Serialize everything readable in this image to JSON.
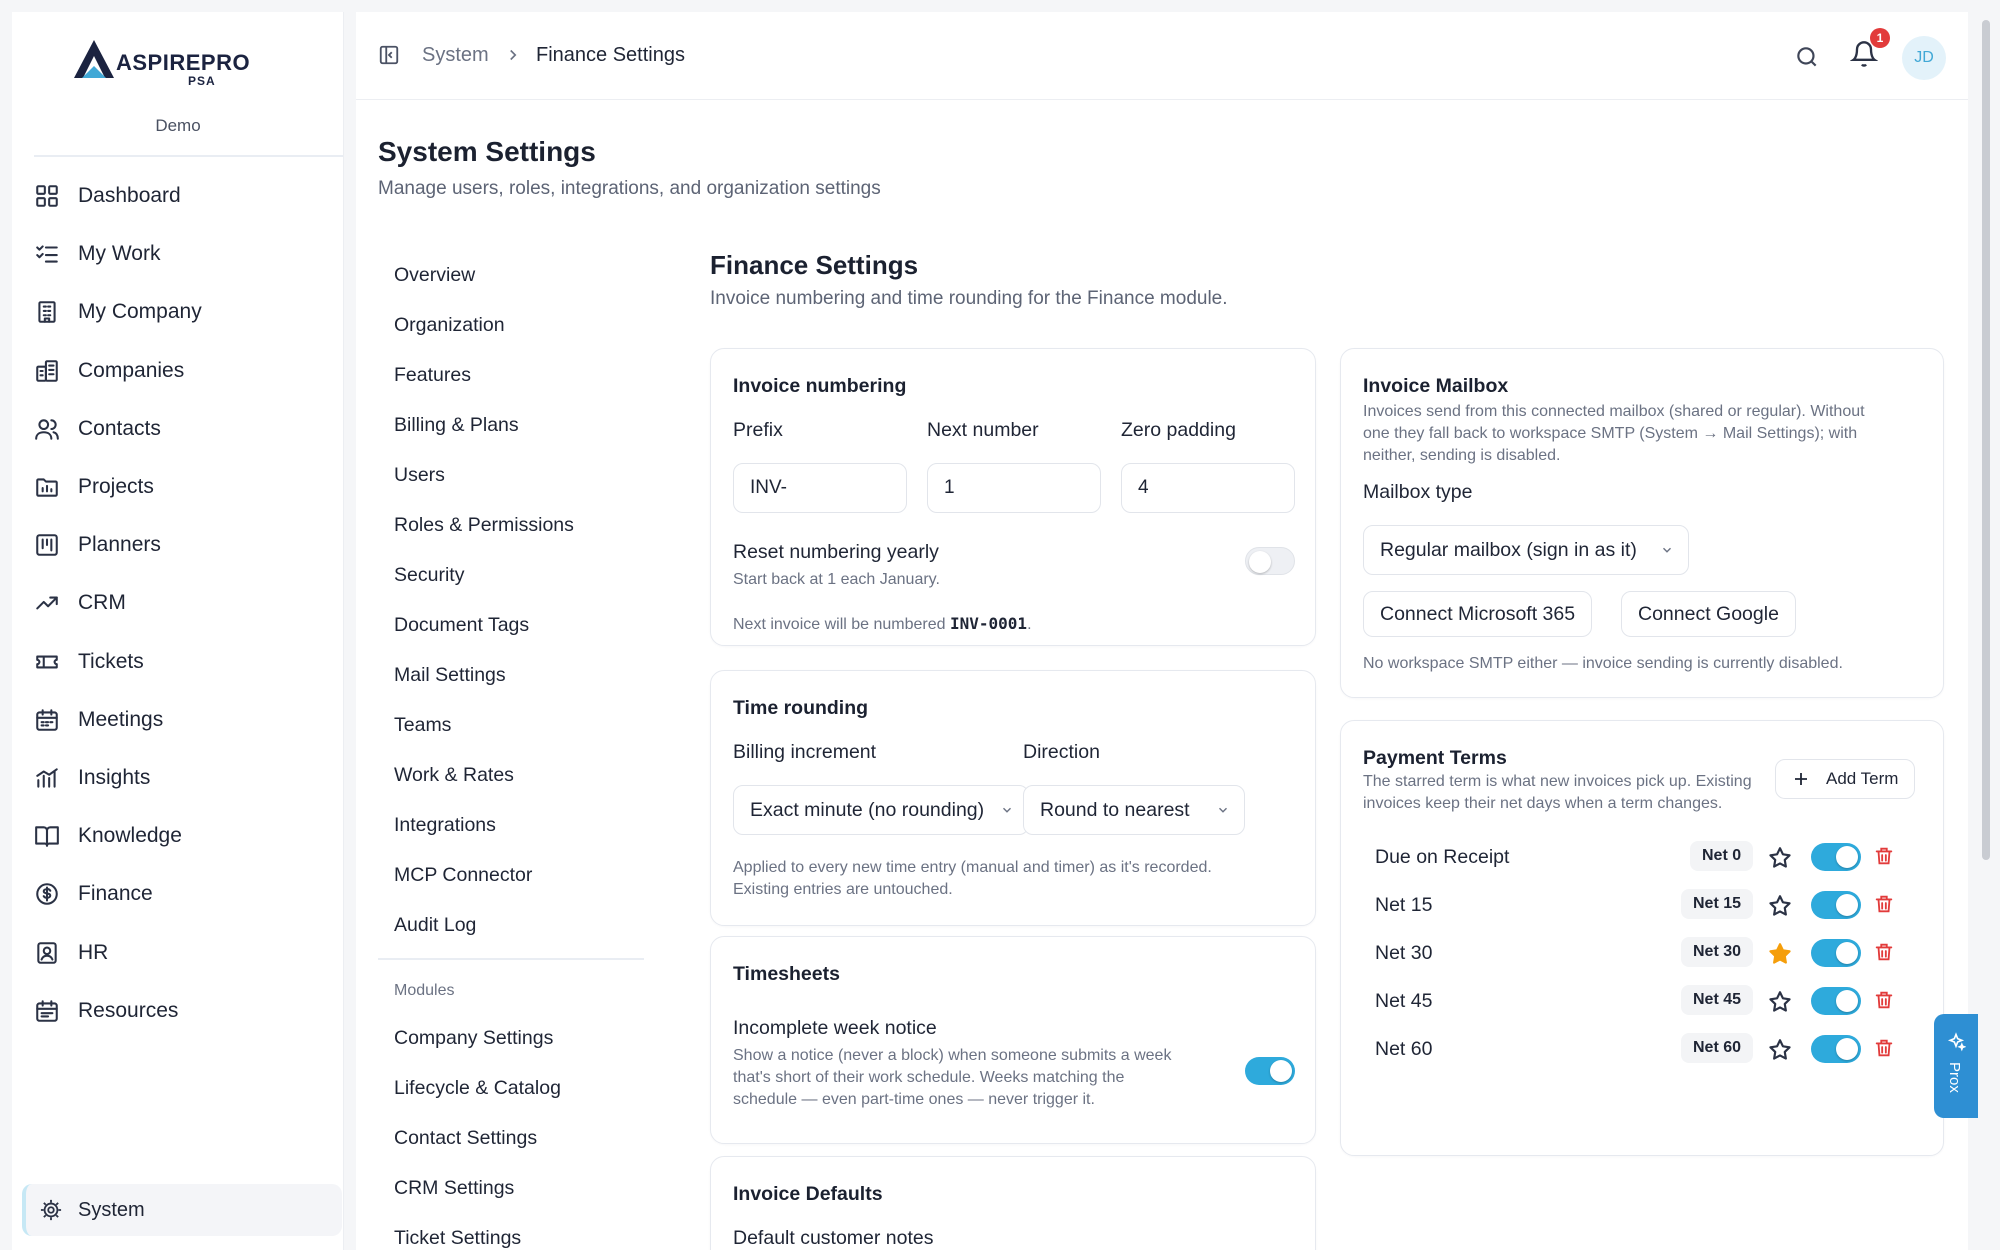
{
  "brand": {
    "name": "ASPIREPRO",
    "sub": "PSA",
    "workspace": "Demo"
  },
  "colors": {
    "accent": "#2eaadc",
    "danger": "#e23b3b",
    "star": "#f59e0b",
    "prox": "#2e8fd3"
  },
  "sidebar": {
    "items": [
      {
        "label": "Dashboard",
        "icon": "dashboard-icon"
      },
      {
        "label": "My Work",
        "icon": "list-check-icon"
      },
      {
        "label": "My Company",
        "icon": "building-icon"
      },
      {
        "label": "Companies",
        "icon": "buildings-icon"
      },
      {
        "label": "Contacts",
        "icon": "users-icon"
      },
      {
        "label": "Projects",
        "icon": "folder-chart-icon"
      },
      {
        "label": "Planners",
        "icon": "kanban-icon"
      },
      {
        "label": "CRM",
        "icon": "trending-up-icon"
      },
      {
        "label": "Tickets",
        "icon": "ticket-icon"
      },
      {
        "label": "Meetings",
        "icon": "calendar-icon"
      },
      {
        "label": "Insights",
        "icon": "bar-chart-icon"
      },
      {
        "label": "Knowledge",
        "icon": "book-icon"
      },
      {
        "label": "Finance",
        "icon": "dollar-icon"
      },
      {
        "label": "HR",
        "icon": "id-badge-icon"
      },
      {
        "label": "Resources",
        "icon": "calendar-grid-icon"
      }
    ],
    "system_label": "System"
  },
  "topbar": {
    "crumb_parent": "System",
    "crumb_current": "Finance Settings",
    "notification_count": "1",
    "avatar": "JD"
  },
  "page": {
    "title": "System Settings",
    "subtitle": "Manage users, roles, integrations, and organization settings"
  },
  "subnav": {
    "items": [
      "Overview",
      "Organization",
      "Features",
      "Billing & Plans",
      "Users",
      "Roles & Permissions",
      "Security",
      "Document Tags",
      "Mail Settings",
      "Teams",
      "Work & Rates",
      "Integrations",
      "MCP Connector",
      "Audit Log"
    ],
    "modules_heading": "Modules",
    "modules": [
      "Company Settings",
      "Lifecycle & Catalog",
      "Contact Settings",
      "CRM Settings",
      "Ticket Settings"
    ]
  },
  "section": {
    "title": "Finance Settings",
    "subtitle": "Invoice numbering and time rounding for the Finance module."
  },
  "invoice_numbering": {
    "title": "Invoice numbering",
    "prefix_label": "Prefix",
    "prefix_value": "INV-",
    "next_label": "Next number",
    "next_value": "1",
    "padding_label": "Zero padding",
    "padding_value": "4",
    "reset_label": "Reset numbering yearly",
    "reset_help": "Start back at 1 each January.",
    "reset_enabled": false,
    "preview_text": "Next invoice will be numbered ",
    "preview_code": "INV-0001",
    "preview_end": "."
  },
  "time_rounding": {
    "title": "Time rounding",
    "increment_label": "Billing increment",
    "increment_value": "Exact minute (no rounding)",
    "direction_label": "Direction",
    "direction_value": "Round to nearest",
    "help_1": "Applied to every new time entry (manual and timer) as it's recorded.",
    "help_2": "Existing entries are untouched."
  },
  "timesheets": {
    "title": "Timesheets",
    "notice_label": "Incomplete week notice",
    "notice_help_1": "Show a notice (never a block) when someone submits a week",
    "notice_help_2": "that's short of their work schedule. Weeks matching the",
    "notice_help_3": "schedule — even part-time ones — never trigger it.",
    "notice_enabled": true
  },
  "invoice_defaults": {
    "title": "Invoice Defaults",
    "notes_label": "Default customer notes"
  },
  "mailbox": {
    "title": "Invoice Mailbox",
    "help_1": "Invoices send from this connected mailbox (shared or regular). Without",
    "help_2": "one they fall back to workspace SMTP (System → Mail Settings); with",
    "help_3": "neither, sending is disabled.",
    "type_label": "Mailbox type",
    "type_value": "Regular mailbox (sign in as it)",
    "ms_button": "Connect Microsoft 365",
    "google_button": "Connect Google",
    "status": "No workspace SMTP either — invoice sending is currently disabled."
  },
  "payment_terms": {
    "title": "Payment Terms",
    "help_1": "The starred term is what new invoices pick up. Existing",
    "help_2": "invoices keep their net days when a term changes.",
    "add_button": "Add Term",
    "terms": [
      {
        "name": "Due on Receipt",
        "code": "Net 0",
        "starred": false,
        "enabled": true
      },
      {
        "name": "Net 15",
        "code": "Net 15",
        "starred": false,
        "enabled": true
      },
      {
        "name": "Net 30",
        "code": "Net 30",
        "starred": true,
        "enabled": true
      },
      {
        "name": "Net 45",
        "code": "Net 45",
        "starred": false,
        "enabled": true
      },
      {
        "name": "Net 60",
        "code": "Net 60",
        "starred": false,
        "enabled": true
      }
    ]
  },
  "assistant": {
    "label": "Prox"
  }
}
